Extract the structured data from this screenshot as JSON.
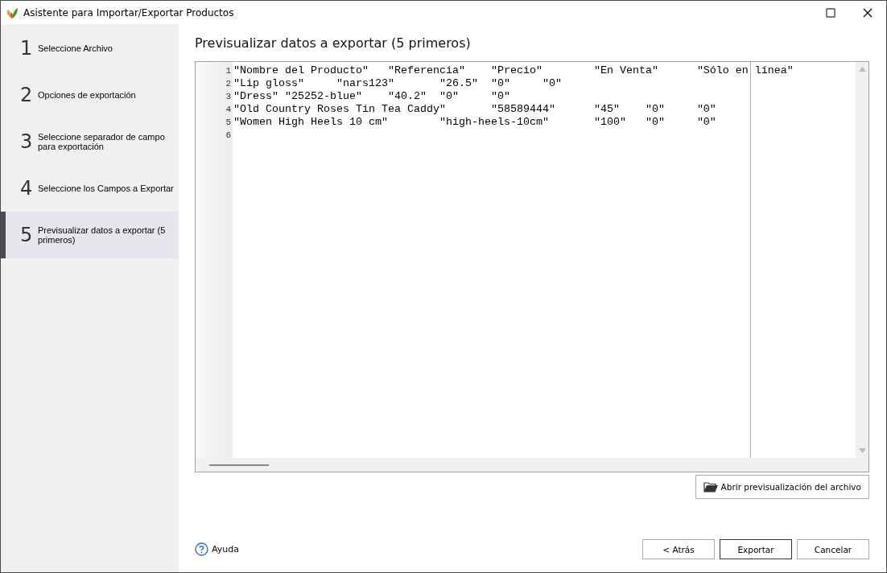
{
  "window": {
    "title": "Asistente para Importar/Exportar Productos"
  },
  "steps": [
    {
      "number": "1",
      "label": "Seleccione Archivo",
      "selected": false
    },
    {
      "number": "2",
      "label": "Opciones de exportación",
      "selected": false
    },
    {
      "number": "3",
      "label": "Seleccione separador de campo para exportación",
      "selected": false
    },
    {
      "number": "4",
      "label": "Seleccione los Campos a Exportar",
      "selected": false
    },
    {
      "number": "5",
      "label": "Previsualizar datos a exportar (5 primeros)",
      "selected": true
    }
  ],
  "heading": "Previsualizar datos a exportar (5 primeros)",
  "preview": {
    "lines": [
      {
        "number": "1",
        "text": "\"Nombre del Producto\"\t\"Referencia\"\t\"Precio\"\t\"En Venta\"\t\"Sólo en línea\""
      },
      {
        "number": "2",
        "text": "\"Lip gloss\"\t\"nars123\"\t\"26.5\"\t\"0\"\t\"0\""
      },
      {
        "number": "3",
        "text": "\"Dress\"\t\"25252-blue\"\t\"40.2\"\t\"0\"\t\"0\""
      },
      {
        "number": "4",
        "text": "\"Old Country Roses Tin Tea Caddy\"\t\"58589444\"\t\"45\"\t\"0\"\t\"0\""
      },
      {
        "number": "5",
        "text": "\"Women High Heels 10 cm\"\t\"high-heels-10cm\"\t\"100\"\t\"0\"\t\"0\""
      },
      {
        "number": "6"
      }
    ]
  },
  "open_preview_button": "Abrir previsualización del archivo",
  "help_link": "Ayuda",
  "buttons": [
    {
      "label": "< Atrás",
      "default": false
    },
    {
      "label": "Exportar",
      "default": true
    },
    {
      "label": "Cancelar",
      "default": false
    }
  ]
}
